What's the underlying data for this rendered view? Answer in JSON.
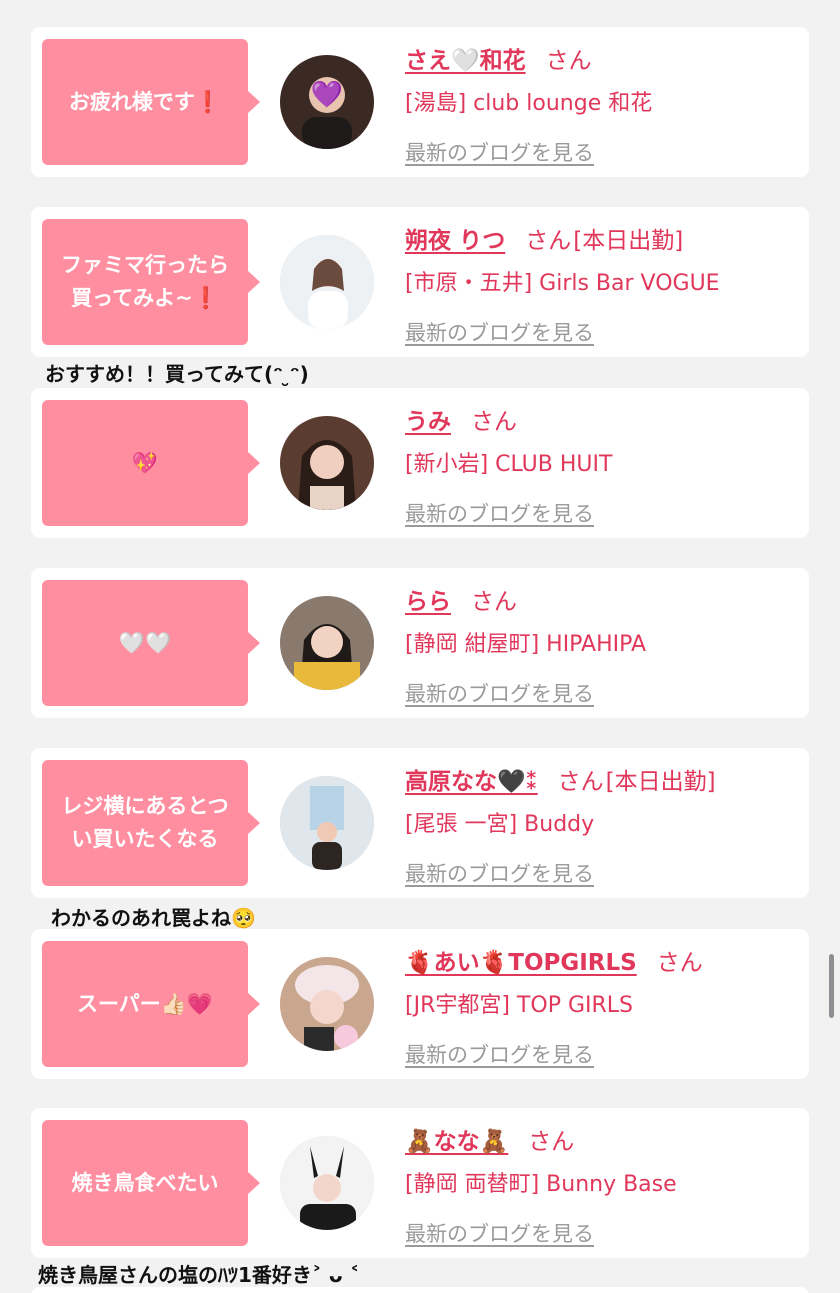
{
  "colors": {
    "accent": "#e0375b",
    "bubble": "#ff8fa0",
    "link_gray": "#9a9a9a",
    "background": "#f2f2f3"
  },
  "cards": [
    {
      "message": "お疲れ様です❗️",
      "name": "さえ🤍和花",
      "san": "さん",
      "shift": "",
      "shop": "[湯島] club lounge 和花",
      "blog_link": "最新のブログを見る",
      "avatar_icon": "avatar-photo-icon"
    },
    {
      "message": "ファミマ行ったら\n買ってみよ~❗️",
      "name": "朔夜 りつ",
      "san": "さん",
      "shift": "[本日出勤]",
      "shop": "[市原・五井] Girls Bar VOGUE",
      "blog_link": "最新のブログを見る",
      "avatar_icon": "avatar-photo-icon"
    },
    {
      "message": "💖",
      "name": "うみ",
      "san": "さん",
      "shift": "",
      "shop": "[新小岩] CLUB HUIT",
      "blog_link": "最新のブログを見る",
      "avatar_icon": "avatar-photo-icon"
    },
    {
      "message": "🤍🤍",
      "name": "らら",
      "san": "さん",
      "shift": "",
      "shop": "[静岡 紺屋町] HIPAHIPA",
      "blog_link": "最新のブログを見る",
      "avatar_icon": "avatar-photo-icon"
    },
    {
      "message": "レジ横にあるとつ\nい買いたくなる",
      "name": "高原なな🖤⁑",
      "san": "さん",
      "shift": "[本日出勤]",
      "shop": "[尾張 一宮] Buddy",
      "blog_link": "最新のブログを見る",
      "avatar_icon": "avatar-photo-icon"
    },
    {
      "message": "スーパー👍🏻💗",
      "name": "🫀あい🫀TOPGIRLS",
      "san": "さん",
      "shift": "",
      "shop": "[JR宇都宮] TOP GIRLS",
      "blog_link": "最新のブログを見る",
      "avatar_icon": "avatar-photo-icon"
    },
    {
      "message": "焼き鳥食べたい",
      "name": "🧸なな🧸",
      "san": "さん",
      "shift": "",
      "shop": "[静岡 両替町] Bunny Base",
      "blog_link": "最新のブログを見る",
      "avatar_icon": "avatar-photo-icon"
    }
  ],
  "captions": [
    "おすすめ！！買ってみて(ᵔ ̮ᵔ)",
    "わかるのあれ罠よね🥺",
    "焼き鳥屋さんの塩のﾊﾂ1番好き˃ ᴗ ˂"
  ]
}
